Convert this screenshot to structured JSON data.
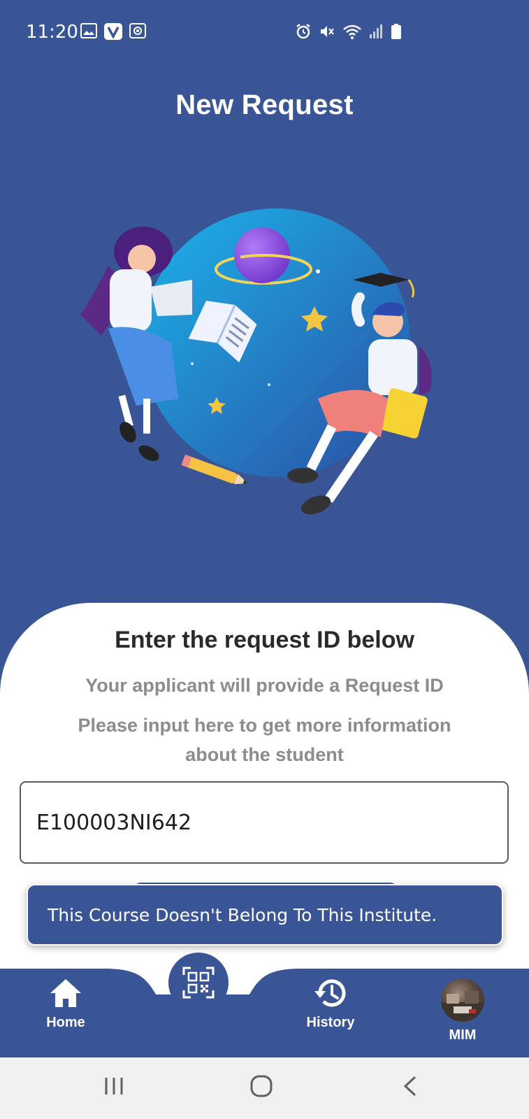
{
  "status_bar": {
    "time": "11:20",
    "icons_left": [
      "image-icon",
      "v-app-icon",
      "screen-record-icon"
    ],
    "icons_right": [
      "alarm-icon",
      "mute-icon",
      "wifi-icon",
      "signal-icon",
      "battery-icon"
    ]
  },
  "header": {
    "title": "New Request"
  },
  "sheet": {
    "heading": "Enter the request ID below",
    "subtitle1": "Your applicant  will provide a  Request ID",
    "subtitle2_line1": "Please input here to get more information",
    "subtitle2_line2": "about the student",
    "input_value": "E100003NI642"
  },
  "snackbar": {
    "message": "This Course Doesn't Belong To This Institute."
  },
  "bottom_nav": {
    "items": [
      {
        "label": "Home",
        "icon": "home-icon"
      },
      {
        "label": "History",
        "icon": "history-icon"
      },
      {
        "label": "MIM",
        "icon": "avatar"
      }
    ],
    "center_icon": "qr-scan-icon"
  },
  "system_nav": {
    "buttons": [
      "recent-apps-icon",
      "home-circle-icon",
      "back-icon"
    ]
  },
  "colors": {
    "primary": "#3a5596",
    "sheet_bg": "#ffffff",
    "heading": "#2a2a2a",
    "muted": "#8c8c8c"
  }
}
